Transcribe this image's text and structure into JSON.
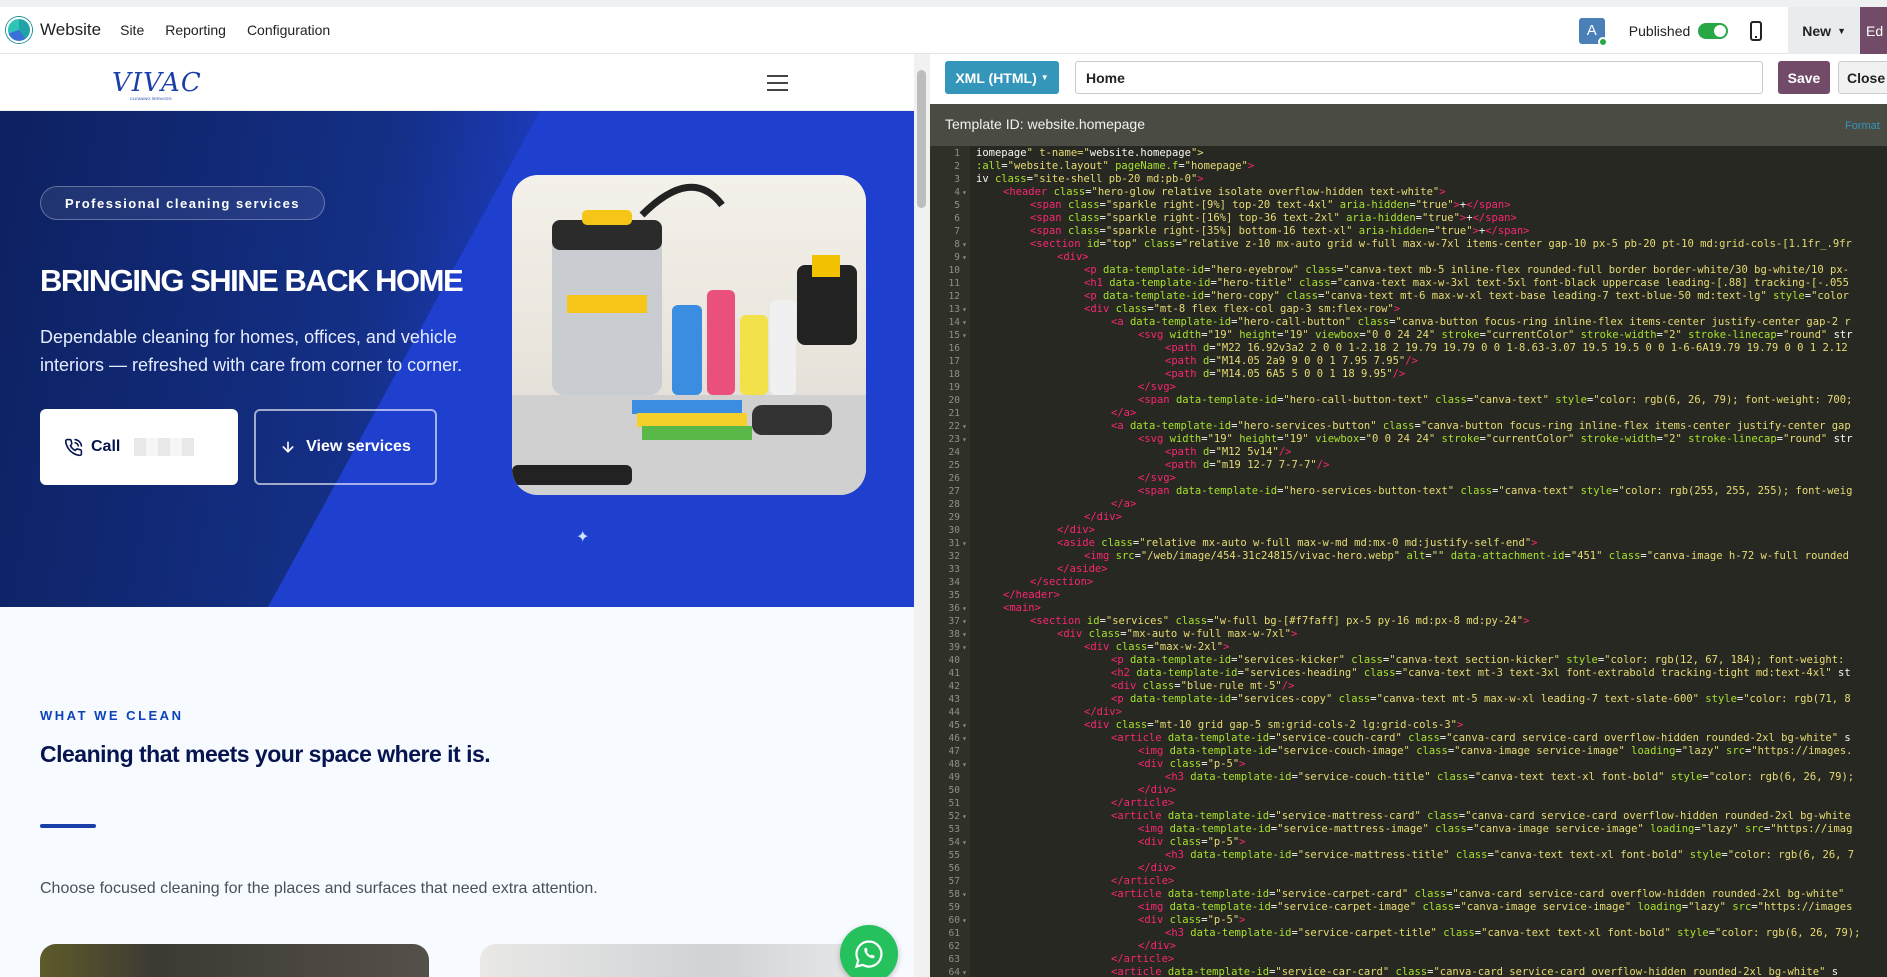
{
  "topbar": {
    "app_name": "Website",
    "menu": [
      "Site",
      "Reporting",
      "Configuration"
    ],
    "avatar_letter": "A",
    "published_label": "Published",
    "published": true,
    "new_label": "New",
    "edit_label": "Ed"
  },
  "site": {
    "logo": "VIVAC",
    "logo_sub": "CLEANING SERVICES",
    "hero_pill": "Professional cleaning services",
    "hero_title": "BRINGING SHINE BACK HOME",
    "hero_copy": "Dependable cleaning for homes, offices, and vehicle interiors — refreshed with care from corner to corner.",
    "call_label": "Call",
    "services_button": "View services",
    "kicker": "WHAT WE CLEAN",
    "services_heading": "Cleaning that meets your space where it is.",
    "services_copy": "Choose focused cleaning for the places and surfaces that need extra attention."
  },
  "editor": {
    "type_button": "XML (HTML)",
    "view_name": "Home",
    "save_label": "Save",
    "close_label": "Close",
    "template_id": "Template ID: website.homepage",
    "format_link": "Format",
    "code_lines": [
      {
        "n": 1,
        "i": 0,
        "t": "iomepage\" t-name=\"website.homepage\">"
      },
      {
        "n": 2,
        "i": 0,
        "t": ":all=\"website.layout\" pageName.f=\"homepage\">"
      },
      {
        "n": 3,
        "i": 0,
        "t": "iv class=\"site-shell pb-20 md:pb-0\">"
      },
      {
        "n": 4,
        "i": 1,
        "t": "<header class=\"hero-glow relative isolate overflow-hidden text-white\">"
      },
      {
        "n": 5,
        "i": 2,
        "t": "<span class=\"sparkle right-[9%] top-20 text-4xl\" aria-hidden=\"true\">+</span>"
      },
      {
        "n": 6,
        "i": 2,
        "t": "<span class=\"sparkle right-[16%] top-36 text-2xl\" aria-hidden=\"true\">+</span>"
      },
      {
        "n": 7,
        "i": 2,
        "t": "<span class=\"sparkle right-[35%] bottom-16 text-xl\" aria-hidden=\"true\">+</span>"
      },
      {
        "n": 8,
        "i": 2,
        "t": "<section id=\"top\" class=\"relative z-10 mx-auto grid w-full max-w-7xl items-center gap-10 px-5 pb-20 pt-10 md:grid-cols-[1.1fr_.9fr"
      },
      {
        "n": 9,
        "i": 3,
        "t": "<div>"
      },
      {
        "n": 10,
        "i": 4,
        "t": "<p data-template-id=\"hero-eyebrow\" class=\"canva-text mb-5 inline-flex rounded-full border border-white/30 bg-white/10 px-"
      },
      {
        "n": 11,
        "i": 4,
        "t": "<h1 data-template-id=\"hero-title\" class=\"canva-text max-w-3xl text-5xl font-black uppercase leading-[.88] tracking-[-.055"
      },
      {
        "n": 12,
        "i": 4,
        "t": "<p data-template-id=\"hero-copy\" class=\"canva-text mt-6 max-w-xl text-base leading-7 text-blue-50 md:text-lg\" style=\"color"
      },
      {
        "n": 13,
        "i": 4,
        "t": "<div class=\"mt-8 flex flex-col gap-3 sm:flex-row\">"
      },
      {
        "n": 14,
        "i": 5,
        "t": "<a data-template-id=\"hero-call-button\" class=\"canva-button focus-ring inline-flex items-center justify-center gap-2 r"
      },
      {
        "n": 15,
        "i": 6,
        "t": "<svg width=\"19\" height=\"19\" viewbox=\"0 0 24 24\" stroke=\"currentColor\" stroke-width=\"2\" stroke-linecap=\"round\" str"
      },
      {
        "n": 16,
        "i": 7,
        "t": "<path d=\"M22 16.92v3a2 2 0 0 1-2.18 2 19.79 19.79 0 0 1-8.63-3.07 19.5 19.5 0 0 1-6-6A19.79 19.79 0 0 1 2.12"
      },
      {
        "n": 17,
        "i": 7,
        "t": "<path d=\"M14.05 2a9 9 0 0 1 7.95 7.95\"/>"
      },
      {
        "n": 18,
        "i": 7,
        "t": "<path d=\"M14.05 6A5 5 0 0 1 18 9.95\"/>"
      },
      {
        "n": 19,
        "i": 6,
        "t": "</svg>"
      },
      {
        "n": 20,
        "i": 6,
        "t": "<span data-template-id=\"hero-call-button-text\" class=\"canva-text\" style=\"color: rgb(6, 26, 79); font-weight: 700;"
      },
      {
        "n": 21,
        "i": 5,
        "t": "</a>"
      },
      {
        "n": 22,
        "i": 5,
        "t": "<a data-template-id=\"hero-services-button\" class=\"canva-button focus-ring inline-flex items-center justify-center gap"
      },
      {
        "n": 23,
        "i": 6,
        "t": "<svg width=\"19\" height=\"19\" viewbox=\"0 0 24 24\" stroke=\"currentColor\" stroke-width=\"2\" stroke-linecap=\"round\" str"
      },
      {
        "n": 24,
        "i": 7,
        "t": "<path d=\"M12 5v14\"/>"
      },
      {
        "n": 25,
        "i": 7,
        "t": "<path d=\"m19 12-7 7-7-7\"/>"
      },
      {
        "n": 26,
        "i": 6,
        "t": "</svg>"
      },
      {
        "n": 27,
        "i": 6,
        "t": "<span data-template-id=\"hero-services-button-text\" class=\"canva-text\" style=\"color: rgb(255, 255, 255); font-weig"
      },
      {
        "n": 28,
        "i": 5,
        "t": "</a>"
      },
      {
        "n": 29,
        "i": 4,
        "t": "</div>"
      },
      {
        "n": 30,
        "i": 3,
        "t": "</div>"
      },
      {
        "n": 31,
        "i": 3,
        "t": "<aside class=\"relative mx-auto w-full max-w-md md:mx-0 md:justify-self-end\">"
      },
      {
        "n": 32,
        "i": 4,
        "t": "<img src=\"/web/image/454-31c24815/vivac-hero.webp\" alt=\"\" data-attachment-id=\"451\" class=\"canva-image h-72 w-full rounded"
      },
      {
        "n": 33,
        "i": 3,
        "t": "</aside>"
      },
      {
        "n": 34,
        "i": 2,
        "t": "</section>"
      },
      {
        "n": 35,
        "i": 1,
        "t": "</header>"
      },
      {
        "n": 36,
        "i": 1,
        "t": "<main>"
      },
      {
        "n": 37,
        "i": 2,
        "t": "<section id=\"services\" class=\"w-full bg-[#f7faff] px-5 py-16 md:px-8 md:py-24\">"
      },
      {
        "n": 38,
        "i": 3,
        "t": "<div class=\"mx-auto w-full max-w-7xl\">"
      },
      {
        "n": 39,
        "i": 4,
        "t": "<div class=\"max-w-2xl\">"
      },
      {
        "n": 40,
        "i": 5,
        "t": "<p data-template-id=\"services-kicker\" class=\"canva-text section-kicker\" style=\"color: rgb(12, 67, 184); font-weight:"
      },
      {
        "n": 41,
        "i": 5,
        "t": "<h2 data-template-id=\"services-heading\" class=\"canva-text mt-3 text-3xl font-extrabold tracking-tight md:text-4xl\" st"
      },
      {
        "n": 42,
        "i": 5,
        "t": "<div class=\"blue-rule mt-5\"/>"
      },
      {
        "n": 43,
        "i": 5,
        "t": "<p data-template-id=\"services-copy\" class=\"canva-text mt-5 max-w-xl leading-7 text-slate-600\" style=\"color: rgb(71, 8"
      },
      {
        "n": 44,
        "i": 4,
        "t": "</div>"
      },
      {
        "n": 45,
        "i": 4,
        "t": "<div class=\"mt-10 grid gap-5 sm:grid-cols-2 lg:grid-cols-3\">"
      },
      {
        "n": 46,
        "i": 5,
        "t": "<article data-template-id=\"service-couch-card\" class=\"canva-card service-card overflow-hidden rounded-2xl bg-white\" s"
      },
      {
        "n": 47,
        "i": 6,
        "t": "<img data-template-id=\"service-couch-image\" class=\"canva-image service-image\" loading=\"lazy\" src=\"https://images."
      },
      {
        "n": 48,
        "i": 6,
        "t": "<div class=\"p-5\">"
      },
      {
        "n": 49,
        "i": 7,
        "t": "<h3 data-template-id=\"service-couch-title\" class=\"canva-text text-xl font-bold\" style=\"color: rgb(6, 26, 79);"
      },
      {
        "n": 50,
        "i": 6,
        "t": "</div>"
      },
      {
        "n": 51,
        "i": 5,
        "t": "</article>"
      },
      {
        "n": 52,
        "i": 5,
        "t": "<article data-template-id=\"service-mattress-card\" class=\"canva-card service-card overflow-hidden rounded-2xl bg-white"
      },
      {
        "n": 53,
        "i": 6,
        "t": "<img data-template-id=\"service-mattress-image\" class=\"canva-image service-image\" loading=\"lazy\" src=\"https://imag"
      },
      {
        "n": 54,
        "i": 6,
        "t": "<div class=\"p-5\">"
      },
      {
        "n": 55,
        "i": 7,
        "t": "<h3 data-template-id=\"service-mattress-title\" class=\"canva-text text-xl font-bold\" style=\"color: rgb(6, 26, 7"
      },
      {
        "n": 56,
        "i": 6,
        "t": "</div>"
      },
      {
        "n": 57,
        "i": 5,
        "t": "</article>"
      },
      {
        "n": 58,
        "i": 5,
        "t": "<article data-template-id=\"service-carpet-card\" class=\"canva-card service-card overflow-hidden rounded-2xl bg-white\""
      },
      {
        "n": 59,
        "i": 6,
        "t": "<img data-template-id=\"service-carpet-image\" class=\"canva-image service-image\" loading=\"lazy\" src=\"https://images"
      },
      {
        "n": 60,
        "i": 6,
        "t": "<div class=\"p-5\">"
      },
      {
        "n": 61,
        "i": 7,
        "t": "<h3 data-template-id=\"service-carpet-title\" class=\"canva-text text-xl font-bold\" style=\"color: rgb(6, 26, 79);"
      },
      {
        "n": 62,
        "i": 6,
        "t": "</div>"
      },
      {
        "n": 63,
        "i": 5,
        "t": "</article>"
      },
      {
        "n": 64,
        "i": 5,
        "t": "<article data-template-id=\"service-car-card\" class=\"canva-card service-card overflow-hidden rounded-2xl bg-white\" s"
      }
    ]
  }
}
